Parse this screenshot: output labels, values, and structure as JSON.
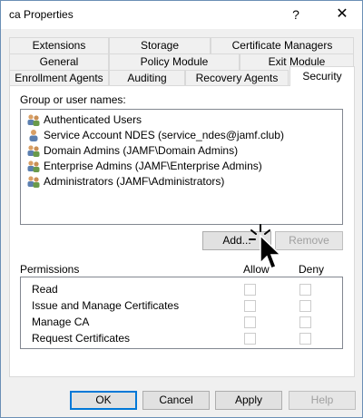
{
  "window": {
    "title": "ca Properties",
    "help_glyph": "?",
    "close_glyph": "✕"
  },
  "tabs": {
    "row1": [
      "Extensions",
      "Storage",
      "Certificate Managers"
    ],
    "row2": [
      "General",
      "Policy Module",
      "Exit Module"
    ],
    "row3": [
      "Enrollment Agents",
      "Auditing",
      "Recovery Agents",
      "Security"
    ],
    "active": "Security"
  },
  "security": {
    "group_label": "Group or user names:",
    "users": [
      {
        "name": "Authenticated Users",
        "icon": "group-icon"
      },
      {
        "name": "Service Account NDES (service_ndes@jamf.club)",
        "icon": "user-icon"
      },
      {
        "name": "Domain Admins (JAMF\\Domain Admins)",
        "icon": "group-icon"
      },
      {
        "name": "Enterprise Admins (JAMF\\Enterprise Admins)",
        "icon": "group-icon"
      },
      {
        "name": "Administrators (JAMF\\Administrators)",
        "icon": "group-icon"
      }
    ],
    "add_label": "Add...",
    "remove_label": "Remove",
    "permissions_label": "Permissions",
    "allow_label": "Allow",
    "deny_label": "Deny",
    "permissions": [
      {
        "name": "Read",
        "allow": false,
        "deny": false
      },
      {
        "name": "Issue and Manage Certificates",
        "allow": false,
        "deny": false
      },
      {
        "name": "Manage CA",
        "allow": false,
        "deny": false
      },
      {
        "name": "Request Certificates",
        "allow": false,
        "deny": false
      }
    ]
  },
  "footer": {
    "ok": "OK",
    "cancel": "Cancel",
    "apply": "Apply",
    "help": "Help"
  },
  "colors": {
    "accent": "#0078d7",
    "disabled_text": "#a0a0a0"
  }
}
